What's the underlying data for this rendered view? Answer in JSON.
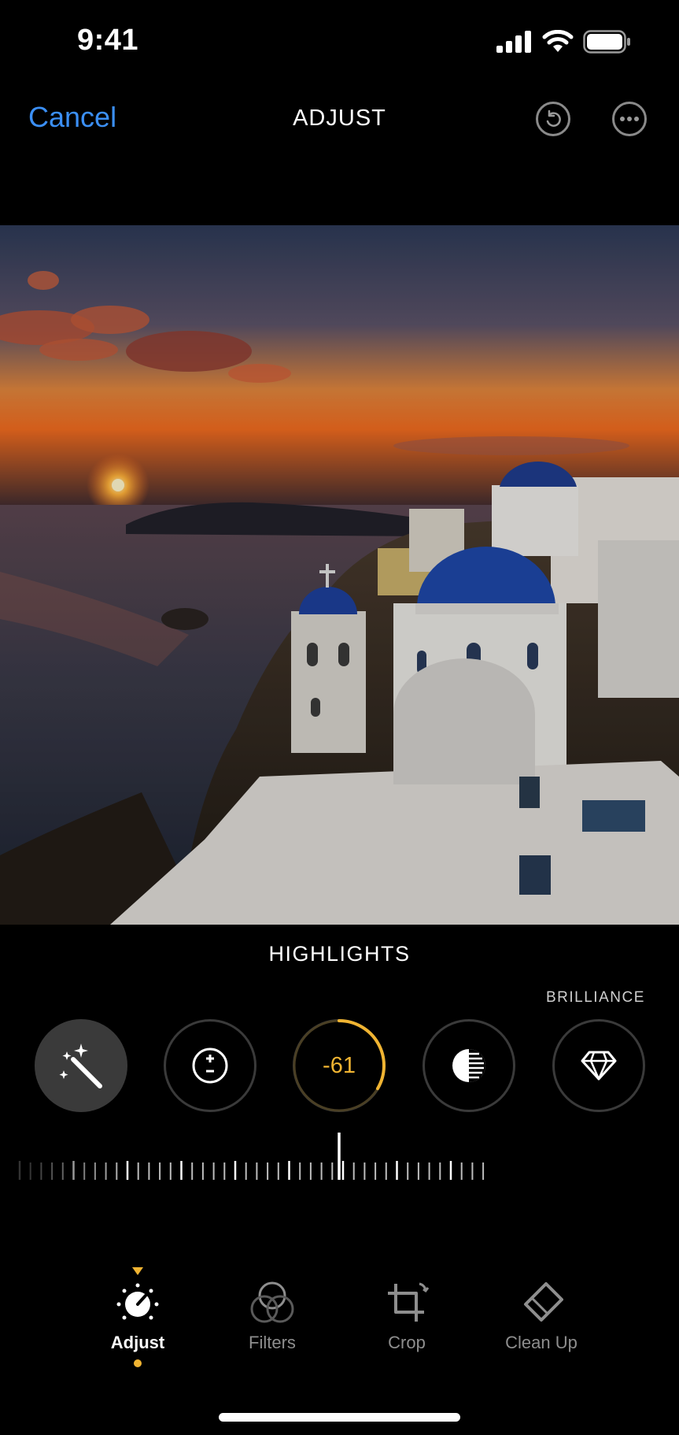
{
  "status_bar": {
    "time": "9:41"
  },
  "nav": {
    "cancel_label": "Cancel",
    "title": "ADJUST"
  },
  "editor": {
    "active_tool_label": "HIGHLIGHTS",
    "next_tool_label": "BRILLIANCE",
    "active_value": "-61",
    "active_value_fraction": 0.61,
    "accent_color": "#f0b432",
    "tools": [
      "auto-enhance-icon",
      "exposure-icon",
      "highlights-dial",
      "shadows-icon",
      "brilliance-icon"
    ]
  },
  "tabs": [
    {
      "label": "Adjust",
      "icon": "adjust-dial-icon",
      "active": true
    },
    {
      "label": "Filters",
      "icon": "filters-circles-icon",
      "active": false
    },
    {
      "label": "Crop",
      "icon": "crop-icon",
      "active": false
    },
    {
      "label": "Clean Up",
      "icon": "eraser-icon",
      "active": false
    }
  ],
  "colors": {
    "link": "#3b8ff5",
    "background": "#000000"
  }
}
